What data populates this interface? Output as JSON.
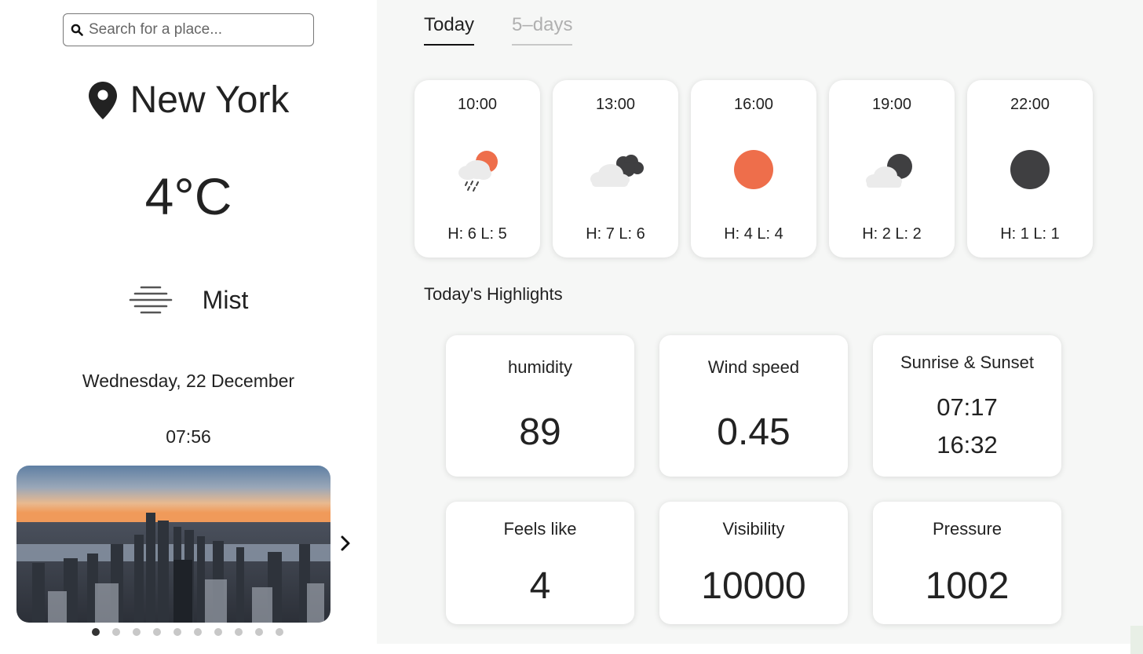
{
  "search": {
    "placeholder": "Search for a place..."
  },
  "location": {
    "city": "New York"
  },
  "current": {
    "temperature": "4°C",
    "condition": "Mist",
    "condition_icon": "mist-icon",
    "date": "Wednesday, 22 December",
    "time": "07:56"
  },
  "carousel": {
    "total_slides": 10,
    "active_index": 0
  },
  "tabs": [
    {
      "label": "Today",
      "active": true
    },
    {
      "label": "5–days",
      "active": false
    }
  ],
  "hourly": [
    {
      "time": "10:00",
      "icon": "rain-sun-icon",
      "hl": "H: 6 L: 5"
    },
    {
      "time": "13:00",
      "icon": "cloudy-icon",
      "hl": "H: 7 L: 6"
    },
    {
      "time": "16:00",
      "icon": "clear-sun-icon",
      "hl": "H: 4 L: 4"
    },
    {
      "time": "19:00",
      "icon": "partly-cloudy-night-icon",
      "hl": "H: 2 L: 2"
    },
    {
      "time": "22:00",
      "icon": "clear-night-icon",
      "hl": "H: 1 L: 1"
    }
  ],
  "highlights": {
    "title": "Today's Highlights",
    "humidity": {
      "label": "humidity",
      "value": "89"
    },
    "wind": {
      "label": "Wind speed",
      "value": "0.45"
    },
    "sun": {
      "label": "Sunrise & Sunset",
      "sunrise": "07:17",
      "sunset": "16:32"
    },
    "feels_like": {
      "label": "Feels like",
      "value": "4"
    },
    "visibility": {
      "label": "Visibility",
      "value": "10000"
    },
    "pressure": {
      "label": "Pressure",
      "value": "1002"
    }
  },
  "colors": {
    "sun_orange": "#ee6e4b",
    "night_dark": "#3f3f41",
    "cloud_light": "#ebebeb",
    "panel_bg": "#f6f7f6"
  }
}
